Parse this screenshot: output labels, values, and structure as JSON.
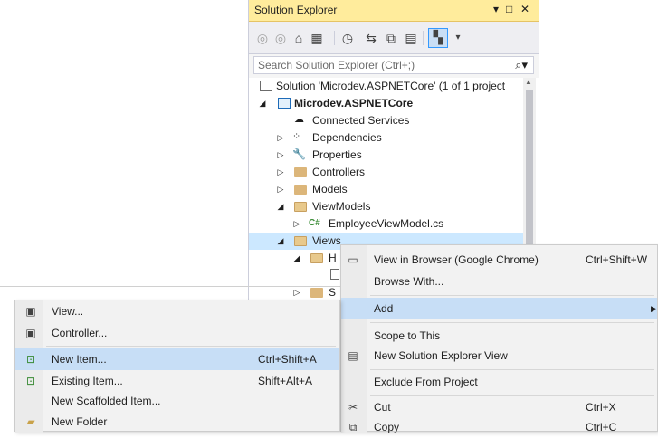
{
  "solution_explorer": {
    "title": "Solution Explorer",
    "title_controls": [
      "▾",
      "□",
      "✕"
    ],
    "toolbar_icons": [
      "back-icon",
      "forward-icon",
      "home-icon",
      "switch-views-icon",
      "pending-changes-icon",
      "sync-icon",
      "collapse-all-icon",
      "show-all-files-icon",
      "properties-icon"
    ],
    "search_placeholder": "Search Solution Explorer (Ctrl+;)",
    "tree": [
      {
        "label": "Solution 'Microdev.ASPNETCore' (1 of 1 project",
        "bold": false
      },
      {
        "label": "Microdev.ASPNETCore",
        "bold": true
      },
      {
        "label": "Connected Services"
      },
      {
        "label": "Dependencies"
      },
      {
        "label": "Properties"
      },
      {
        "label": "Controllers"
      },
      {
        "label": "Models"
      },
      {
        "label": "ViewModels"
      },
      {
        "label": "EmployeeViewModel.cs",
        "prefix": "C#"
      },
      {
        "label": "Views"
      },
      {
        "label": "H"
      },
      {
        "label": "S"
      }
    ]
  },
  "context_menu": {
    "items": [
      {
        "label": "View in Browser (Google Chrome)",
        "shortcut": "Ctrl+Shift+W",
        "icon": "browser-icon"
      },
      {
        "label": "Browse With...",
        "shortcut": ""
      },
      {
        "label": "Add",
        "shortcut": "",
        "has_submenu": true,
        "highlighted": true
      },
      {
        "label": "Scope to This",
        "shortcut": ""
      },
      {
        "label": "New Solution Explorer View",
        "shortcut": "",
        "icon": "new-view-icon"
      },
      {
        "label": "Exclude From Project",
        "shortcut": ""
      },
      {
        "label": "Cut",
        "shortcut": "Ctrl+X",
        "icon": "cut-icon"
      },
      {
        "label": "Copy",
        "shortcut": "Ctrl+C",
        "icon": "copy-icon"
      }
    ]
  },
  "add_submenu": {
    "items": [
      {
        "label": "View...",
        "shortcut": "",
        "icon": "view-file-icon"
      },
      {
        "label": "Controller...",
        "shortcut": "",
        "icon": "controller-file-icon"
      },
      {
        "label": "New Item...",
        "shortcut": "Ctrl+Shift+A",
        "icon": "new-item-icon",
        "highlighted": true
      },
      {
        "label": "Existing Item...",
        "shortcut": "Shift+Alt+A",
        "icon": "existing-item-icon"
      },
      {
        "label": "New Scaffolded Item...",
        "shortcut": ""
      },
      {
        "label": "New Folder",
        "shortcut": "",
        "icon": "new-folder-icon"
      }
    ]
  },
  "colors": {
    "title_bar": "#ffec9c",
    "menu_highlight": "#c7def6",
    "tree_selection": "#cce8ff",
    "folder": "#dcb67a"
  }
}
